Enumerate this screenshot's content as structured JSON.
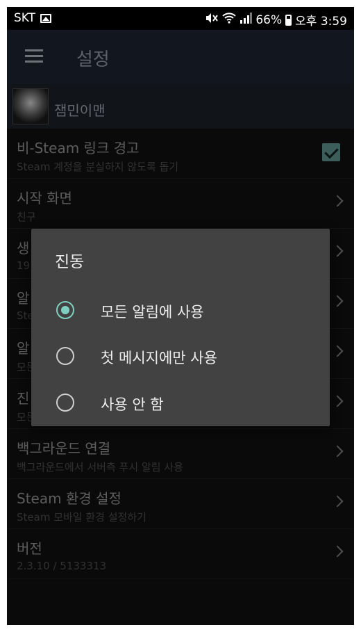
{
  "status_bar": {
    "carrier": "SKT",
    "battery_percent": "66%",
    "time": "오후 3:59",
    "icons": [
      "gallery-icon",
      "mute-icon",
      "wifi-icon",
      "signal-icon",
      "battery-icon"
    ]
  },
  "app_bar": {
    "title": "설정",
    "menu_icon": "hamburger-icon"
  },
  "profile": {
    "name": "잼민이맨"
  },
  "settings": {
    "items": [
      {
        "title": "비-Steam 링크 경고",
        "subtitle": "Steam 계정을 분실하지 않도록 돕기",
        "control": "checkbox",
        "checked": true
      },
      {
        "title": "시작 화면",
        "subtitle": "친구",
        "control": "chevron"
      },
      {
        "title": "생",
        "subtitle": "19",
        "control": "chevron"
      },
      {
        "title": "알",
        "subtitle": "Ste",
        "control": "chevron"
      },
      {
        "title": "알",
        "subtitle": "모든",
        "control": "chevron"
      },
      {
        "title": "진",
        "subtitle": "모든",
        "control": "chevron"
      },
      {
        "title": "백그라운드 연결",
        "subtitle": "백그라운드에서 서버측 푸시 알림 사용",
        "control": "chevron"
      },
      {
        "title": "Steam 환경 설정",
        "subtitle": "Steam 모바일 환경 설정하기",
        "control": "chevron"
      },
      {
        "title": "버전",
        "subtitle": "2.3.10 / 5133313",
        "control": "chevron"
      }
    ]
  },
  "dialog": {
    "title": "진동",
    "options": [
      {
        "label": "모든 알림에 사용",
        "selected": true
      },
      {
        "label": "첫 메시지에만 사용",
        "selected": false
      },
      {
        "label": "사용 안 함",
        "selected": false
      }
    ]
  },
  "colors": {
    "accent": "#7fcfc1",
    "app_bar": "#1d2330",
    "background": "#101010",
    "dialog": "#424242"
  }
}
